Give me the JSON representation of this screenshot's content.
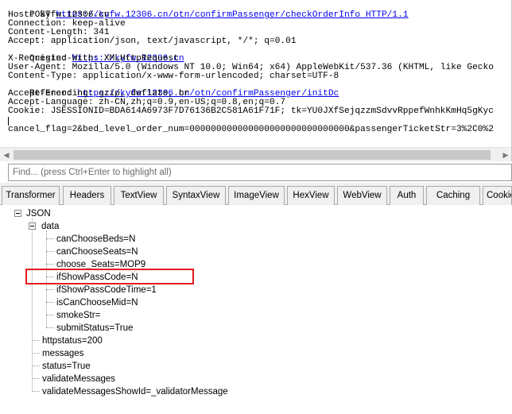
{
  "request": {
    "lines": [
      {
        "prefix": "POST ",
        "link": "https://kyfw.12306.cn/otn/confirmPassenger/checkOrderInfo HTTP/1.1",
        "suffix": ""
      },
      {
        "prefix": "Host: kyfw.12306.cn",
        "link": "",
        "suffix": ""
      },
      {
        "prefix": "Connection: keep-alive",
        "link": "",
        "suffix": ""
      },
      {
        "prefix": "Content-Length: 341",
        "link": "",
        "suffix": ""
      },
      {
        "prefix": "Accept: application/json, text/javascript, */*; q=0.01",
        "link": "",
        "suffix": ""
      },
      {
        "prefix": "Origin: ",
        "link": "https://kyfw.12306.cn",
        "suffix": ""
      },
      {
        "prefix": "X-Requested-With: XMLHttpRequest",
        "link": "",
        "suffix": ""
      },
      {
        "prefix": "User-Agent: Mozilla/5.0 (Windows NT 10.0; Win64; x64) AppleWebKit/537.36 (KHTML, like Gecko",
        "link": "",
        "suffix": ""
      },
      {
        "prefix": "Content-Type: application/x-www-form-urlencoded; charset=UTF-8",
        "link": "",
        "suffix": ""
      },
      {
        "prefix": "Referer: ",
        "link": "https://kyfw.12306.cn/otn/confirmPassenger/initDc",
        "suffix": ""
      },
      {
        "prefix": "Accept-Encoding: gzip, deflate, br",
        "link": "",
        "suffix": ""
      },
      {
        "prefix": "Accept-Language: zh-CN,zh;q=0.9,en-US;q=0.8,en;q=0.7",
        "link": "",
        "suffix": ""
      },
      {
        "prefix": "Cookie: JSESSIONID=BDA614A6973F7D76136B2C581A61F71F; tk=YU0JXfSejqzzmSdvvRppefWnhkKmHq5gKyc",
        "link": "",
        "suffix": ""
      }
    ],
    "body": "cancel_flag=2&bed_level_order_num=000000000000000000000000000000&passengerTicketStr=3%2C0%2"
  },
  "find": {
    "placeholder": "Find... (press Ctrl+Enter to highlight all)"
  },
  "tabs": [
    {
      "label": "Transformer",
      "active": false
    },
    {
      "label": "Headers",
      "active": false
    },
    {
      "label": "TextView",
      "active": false
    },
    {
      "label": "SyntaxView",
      "active": false
    },
    {
      "label": "ImageView",
      "active": false
    },
    {
      "label": "HexView",
      "active": false
    },
    {
      "label": "WebView",
      "active": false
    },
    {
      "label": "Auth",
      "active": false
    },
    {
      "label": "Caching",
      "active": false
    },
    {
      "label": "Cookies",
      "active": false
    }
  ],
  "tree": {
    "root": "JSON",
    "data_label": "data",
    "data_children": [
      "canChooseBeds=N",
      "canChooseSeats=N",
      "choose_Seats=MOP9",
      "ifShowPassCode=N",
      "ifShowPassCodeTime=1",
      "isCanChooseMid=N",
      "smokeStr=",
      "submitStatus=True"
    ],
    "root_children": [
      "httpstatus=200",
      "messages",
      "status=True",
      "validateMessages",
      "validateMessagesShowId=_validatorMessage"
    ]
  },
  "highlight_color": "#e41a1c"
}
